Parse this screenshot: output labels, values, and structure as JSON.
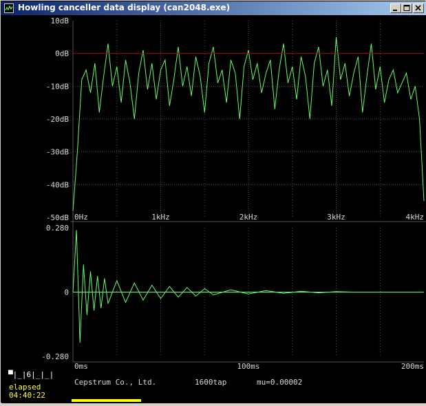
{
  "window": {
    "title": "Howling canceller data display (can2048.exe)",
    "icons": [
      "app-icon",
      "minimize-icon",
      "maximize-icon",
      "close-icon"
    ]
  },
  "colors": {
    "trace": "#66ff66",
    "grid": "#555555",
    "reference_line": "#b00000",
    "axis_text": "#d8d8d8",
    "elapsed_text": "#ffff33",
    "progress_bar": "#ffff00"
  },
  "chart_data": [
    {
      "type": "line",
      "name": "spectrum",
      "x_ticks": [
        "0Hz",
        "1kHz",
        "2kHz",
        "3kHz",
        "4kHz"
      ],
      "y_ticks": [
        "10dB",
        "0dB",
        "-10dB",
        "-20dB",
        "-30dB",
        "-40dB",
        "-50dB"
      ],
      "xlim": [
        0,
        4000
      ],
      "ylim": [
        -50,
        10
      ],
      "reference_line_db": 0,
      "grid": true,
      "x": [
        0,
        50,
        100,
        150,
        200,
        250,
        300,
        350,
        400,
        450,
        500,
        550,
        600,
        650,
        700,
        750,
        800,
        850,
        900,
        950,
        1000,
        1050,
        1100,
        1150,
        1200,
        1250,
        1300,
        1350,
        1400,
        1450,
        1500,
        1550,
        1600,
        1650,
        1700,
        1750,
        1800,
        1850,
        1900,
        1950,
        2000,
        2050,
        2100,
        2150,
        2200,
        2250,
        2300,
        2350,
        2400,
        2450,
        2500,
        2550,
        2600,
        2650,
        2700,
        2750,
        2800,
        2850,
        2900,
        2950,
        3000,
        3050,
        3100,
        3150,
        3200,
        3250,
        3300,
        3350,
        3400,
        3450,
        3500,
        3550,
        3600,
        3650,
        3700,
        3750,
        3800,
        3850,
        3900,
        3950,
        4000
      ],
      "values": [
        -48,
        -30,
        -8,
        -5,
        -12,
        -3,
        -18,
        -7,
        3,
        -10,
        -4,
        -15,
        -2,
        -9,
        -20,
        -6,
        1,
        -11,
        -3,
        -14,
        -5,
        -2,
        -16,
        -8,
        2,
        -10,
        -4,
        -13,
        -1,
        -7,
        -18,
        -3,
        2,
        -9,
        -5,
        -15,
        -2,
        -6,
        -20,
        -4,
        1,
        -8,
        -3,
        -12,
        -6,
        -2,
        -17,
        -5,
        3,
        -9,
        -4,
        -14,
        -1,
        -7,
        -20,
        -3,
        2,
        -10,
        -5,
        -16,
        5,
        -8,
        -3,
        -13,
        -6,
        -1,
        -18,
        -7,
        3,
        -11,
        -4,
        -15,
        -8,
        -5,
        -12,
        -9,
        -6,
        -14,
        -10,
        -20,
        -45
      ]
    },
    {
      "type": "line",
      "name": "impulse_response",
      "x_ticks": [
        "0ms",
        "100ms",
        "200ms"
      ],
      "y_ticks": [
        "0.280",
        "0",
        "-0.280"
      ],
      "xlim": [
        0,
        200
      ],
      "ylim": [
        -0.28,
        0.28
      ],
      "grid": true,
      "x": [
        0,
        2,
        4,
        6,
        8,
        10,
        12,
        14,
        16,
        18,
        20,
        25,
        30,
        35,
        40,
        45,
        50,
        55,
        60,
        65,
        70,
        75,
        80,
        90,
        100,
        110,
        120,
        130,
        140,
        150,
        160,
        180,
        200
      ],
      "values": [
        0,
        0.27,
        -0.22,
        0.12,
        -0.1,
        0.09,
        -0.08,
        0.07,
        -0.07,
        0.06,
        -0.05,
        0.05,
        -0.045,
        0.04,
        -0.035,
        0.03,
        -0.028,
        0.025,
        -0.022,
        0.02,
        -0.017,
        0.015,
        -0.012,
        0.01,
        -0.008,
        0.007,
        -0.005,
        0.004,
        -0.003,
        0.002,
        0,
        0,
        0
      ]
    }
  ],
  "status": {
    "tab_number": "6",
    "tab_indicator": "▀|_|6|_|_|",
    "elapsed_label": "elapsed",
    "elapsed_time": "04:40:22",
    "company": "Cepstrum Co., Ltd.",
    "taps": "1600tap",
    "mu": "mu=0.00002",
    "progress": 0.36
  }
}
